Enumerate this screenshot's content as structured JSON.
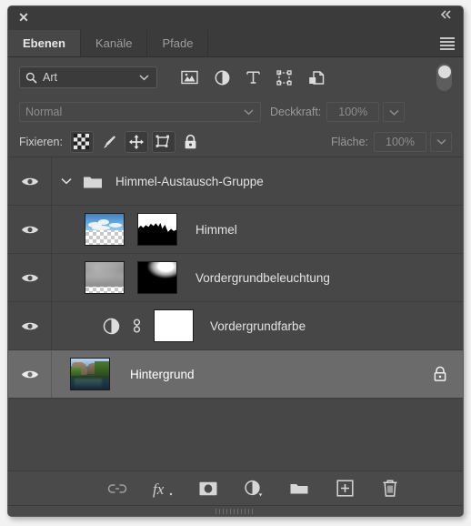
{
  "window": {
    "close_label": "✕",
    "collapse_label": "«"
  },
  "tabs": [
    {
      "label": "Ebenen",
      "active": true
    },
    {
      "label": "Kanäle",
      "active": false
    },
    {
      "label": "Pfade",
      "active": false
    }
  ],
  "panel_menu": {
    "name": "panel-menu-icon"
  },
  "filter": {
    "type_label": "Art",
    "search_icon": "search-icon",
    "caret_icon": "chevron-down-icon",
    "icons": [
      {
        "name": "filter-pixel-layers-icon"
      },
      {
        "name": "filter-adjustment-layers-icon"
      },
      {
        "name": "filter-type-layers-icon"
      },
      {
        "name": "filter-shape-layers-icon"
      },
      {
        "name": "filter-smart-object-layers-icon"
      }
    ],
    "toggle": {
      "name": "filter-enable-toggle",
      "state": "off"
    }
  },
  "blend": {
    "mode": "Normal",
    "opacity_label": "Deckkraft:",
    "opacity_value": "100%"
  },
  "lock": {
    "label": "Fixieren:",
    "buttons": [
      {
        "name": "lock-transparent-pixels-button",
        "active": true
      },
      {
        "name": "lock-image-pixels-button",
        "active": false
      },
      {
        "name": "lock-position-button",
        "active": true
      },
      {
        "name": "lock-artboard-nesting-button",
        "active": true
      },
      {
        "name": "lock-all-button",
        "active": false
      }
    ],
    "fill_label": "Fläche:",
    "fill_value": "100%"
  },
  "layers": [
    {
      "name": "Himmel-Austausch-Gruppe",
      "kind": "group",
      "visible": true,
      "selected": false,
      "expanded": true,
      "locked": false
    },
    {
      "name": "Himmel",
      "kind": "pixel-with-mask",
      "visible": true,
      "selected": false,
      "locked": false
    },
    {
      "name": "Vordergrundbeleuchtung",
      "kind": "pixel-with-mask",
      "visible": true,
      "selected": false,
      "locked": false
    },
    {
      "name": "Vordergrundfarbe",
      "kind": "adjustment-with-mask",
      "visible": true,
      "selected": false,
      "locked": false
    },
    {
      "name": "Hintergrund",
      "kind": "background",
      "visible": true,
      "selected": true,
      "locked": true
    }
  ],
  "bottom_toolbar": [
    {
      "name": "link-layers-button"
    },
    {
      "name": "layer-style-fx-button"
    },
    {
      "name": "add-layer-mask-button"
    },
    {
      "name": "new-adjustment-layer-button"
    },
    {
      "name": "new-group-button"
    },
    {
      "name": "new-layer-button"
    },
    {
      "name": "delete-layer-button"
    }
  ],
  "colors": {
    "panel_bg": "#474747",
    "header_bg": "#3b3b3b",
    "selected_row": "#6b6b6b",
    "text": "#e3e3e3",
    "muted_text": "#9a9a9a"
  }
}
